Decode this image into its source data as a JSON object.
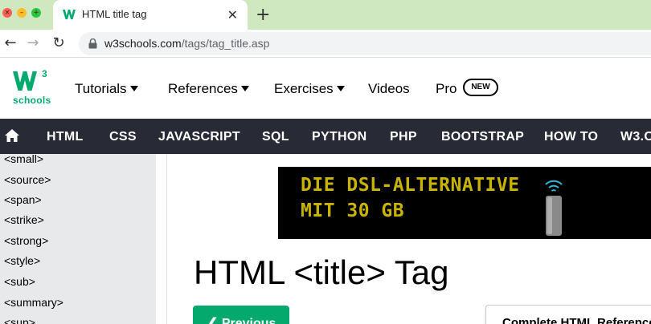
{
  "browser": {
    "tab_title": "HTML title tag",
    "url_domain": "w3schools.com",
    "url_path": "/tags/tag_title.asp"
  },
  "header": {
    "logo_mark": "W",
    "logo_sup": "3",
    "logo_text": "schools",
    "nav": {
      "tutorials": "Tutorials",
      "references": "References",
      "exercises": "Exercises",
      "videos": "Videos",
      "pro": "Pro",
      "new_badge": "NEW"
    }
  },
  "topnav": {
    "items": [
      "HTML",
      "CSS",
      "JAVASCRIPT",
      "SQL",
      "PYTHON",
      "PHP",
      "BOOTSTRAP",
      "HOW TO",
      "W3.C"
    ]
  },
  "sidebar": {
    "items": [
      "<small>",
      "<source>",
      "<span>",
      "<strike>",
      "<strong>",
      "<style>",
      "<sub>",
      "<summary>",
      "<sup>"
    ]
  },
  "ad": {
    "line1": "DIE DSL-ALTERNATIVE",
    "line2": "MIT 30 GB"
  },
  "main": {
    "title": "HTML <title> Tag",
    "previous_label": "❮ Previous",
    "reference_label": "Complete HTML Reference"
  },
  "colors": {
    "tab_strip": "#cfe8c0",
    "brand_green": "#04aa6d",
    "topnav_bg": "#282a35",
    "sidebar_bg": "#e7e9eb",
    "ad_text": "#c8b400"
  }
}
